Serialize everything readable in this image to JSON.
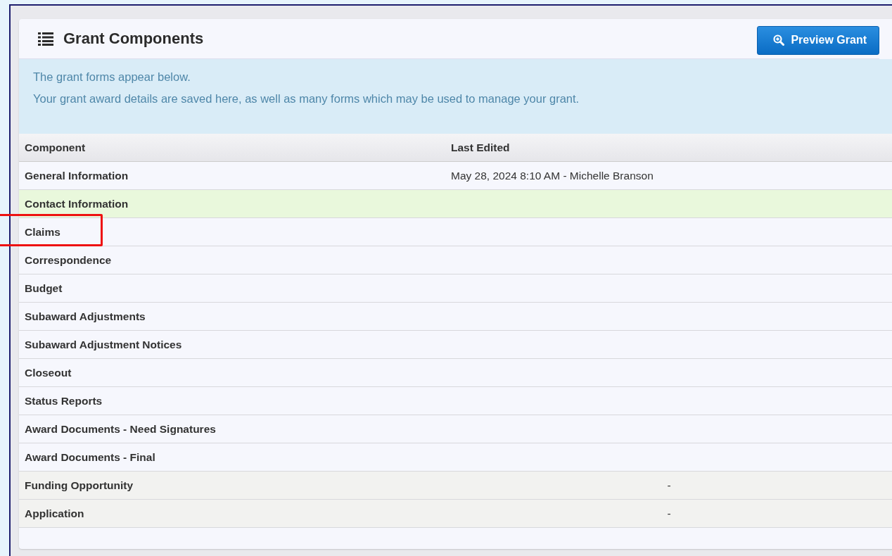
{
  "panel": {
    "title": "Grant Components",
    "preview_button": "Preview Grant"
  },
  "info": [
    "The grant forms appear below.",
    "Your grant award details are saved here, as well as many forms which may be used to manage your grant."
  ],
  "table": {
    "columns": [
      "Component",
      "Last Edited"
    ],
    "rows": [
      {
        "component": "General Information",
        "last_edited": "May 28, 2024 8:10 AM - Michelle Branson",
        "kind": "form",
        "highlighted": false,
        "annotated": false
      },
      {
        "component": "Contact Information",
        "kind": "form",
        "highlighted": true,
        "annotated": false
      },
      {
        "component": "Claims",
        "kind": "form",
        "highlighted": false,
        "annotated": true
      },
      {
        "component": "Correspondence",
        "kind": "form",
        "highlighted": false,
        "annotated": false
      },
      {
        "component": "Budget",
        "kind": "form",
        "highlighted": false,
        "annotated": false
      },
      {
        "component": "Subaward Adjustments",
        "kind": "form",
        "highlighted": false,
        "annotated": false
      },
      {
        "component": "Subaward Adjustment Notices",
        "kind": "form",
        "highlighted": false,
        "annotated": false
      },
      {
        "component": "Closeout",
        "kind": "form",
        "highlighted": false,
        "annotated": false
      },
      {
        "component": "Status Reports",
        "kind": "form",
        "highlighted": false,
        "annotated": false
      },
      {
        "component": "Award Documents - Need Signatures",
        "kind": "form",
        "highlighted": false,
        "annotated": false
      },
      {
        "component": "Award Documents - Final",
        "kind": "form",
        "highlighted": false,
        "annotated": false
      },
      {
        "component": "Funding Opportunity",
        "last_edited": "-",
        "kind": "external",
        "highlighted": false,
        "annotated": false
      },
      {
        "component": "Application",
        "last_edited": "-",
        "kind": "external",
        "highlighted": false,
        "annotated": false
      }
    ]
  }
}
